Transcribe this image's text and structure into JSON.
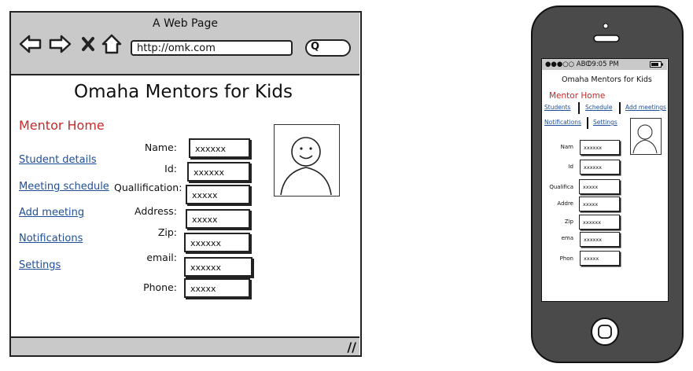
{
  "browser": {
    "title": "A Web Page",
    "url": "http://omk.com",
    "nav_icons": [
      "back-arrow-icon",
      "forward-arrow-icon",
      "close-icon",
      "home-icon"
    ],
    "site_title": "Omaha Mentors for Kids",
    "section_title": "Mentor Home",
    "nav_links": [
      "Student details",
      "Meeting schedule",
      "Add meeting",
      "Notifications",
      "Settings"
    ],
    "form": [
      {
        "label": "Name:",
        "value": "xxxxxx"
      },
      {
        "label": "Id:",
        "value": "xxxxxx"
      },
      {
        "label": "Quallification:",
        "value": "xxxxx"
      },
      {
        "label": "Address:",
        "value": "xxxxx"
      },
      {
        "label": "Zip:",
        "value": "xxxxxx"
      },
      {
        "label": "email:",
        "value": "xxxxxx"
      },
      {
        "label": "Phone:",
        "value": "xxxxx"
      }
    ]
  },
  "phone": {
    "status": "●●●○○ ABC",
    "time": "09:05 PM",
    "title": "Omaha Mentors for Kids",
    "section_title": "Mentor Home",
    "links_row1": [
      "Students",
      "Schedule",
      "Add meetings"
    ],
    "links_row2": [
      "Notifications",
      "Settings"
    ],
    "form": [
      {
        "label": "Nam",
        "value": "xxxxxx"
      },
      {
        "label": "Id",
        "value": "xxxxxx"
      },
      {
        "label": "Qualifica",
        "value": "xxxxx"
      },
      {
        "label": "Addre",
        "value": "xxxxx"
      },
      {
        "label": "Zip",
        "value": "xxxxxx"
      },
      {
        "label": "ema",
        "value": "xxxxxx"
      },
      {
        "label": "Phon",
        "value": "xxxxx"
      }
    ]
  },
  "colors": {
    "chrome_gray": "#c9c9c9",
    "accent_red": "#c62a2a",
    "link_blue": "#1f4f98",
    "phone_body": "#4a4a4a"
  }
}
